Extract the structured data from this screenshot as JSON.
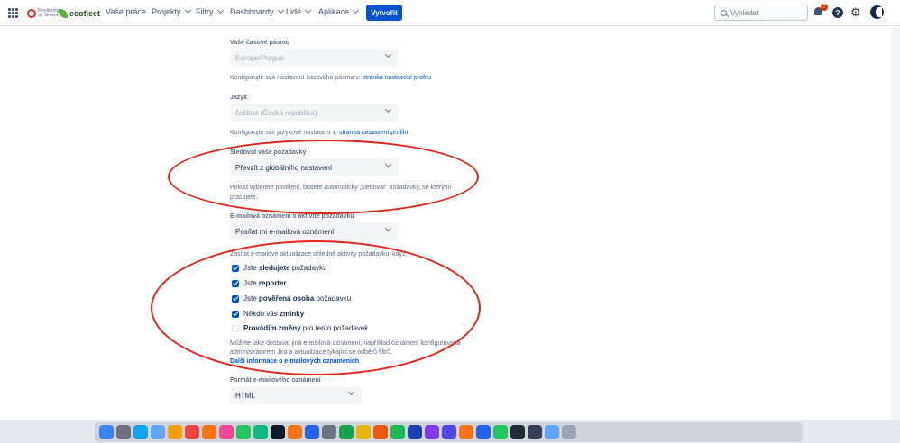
{
  "nav": {
    "logo1_text": "Monitoring as Service",
    "logo2_text": "ecofleet",
    "links": [
      "Vaše práce",
      "Projekty",
      "Filtry",
      "Dashboardy",
      "Lidé",
      "Aplikace"
    ],
    "create_label": "Vytvořit",
    "search_placeholder": "Vyhledat",
    "notification_count": "7",
    "help_glyph": "?"
  },
  "timezone": {
    "label": "Vaše časové pásmo",
    "value": "Europe/Prague",
    "hint_prefix": "Konfigurujte svá nastavení časového pásma v: ",
    "hint_link": "stránka nastavení profilu"
  },
  "language": {
    "label": "Jazyk",
    "value": "čeština (Česká republika)",
    "hint_prefix": "Konfigurujte své jazykové nastavení v: ",
    "hint_link": "stránka nastavení profilu"
  },
  "watch": {
    "label": "Sledovat vaše požadavky",
    "value": "Převzít z globálního nastavení",
    "hint_line1": "Pokud vyberete povolení, budete automaticky „sledovat\" požadavky, se kterými",
    "hint_line2": "pracujete."
  },
  "email_activity": {
    "label": "E-mailová oznámení o aktivitě požadavku",
    "value": "Posílat mi e-mailová oznámení"
  },
  "send_updates": {
    "label": "Zasílat e-mailové aktualizace ohledně aktivity požadavku, když:",
    "items": [
      {
        "pre": "Jste ",
        "bold": "sledujete",
        "post": " požadavku",
        "checked": true
      },
      {
        "pre": "Jste ",
        "bold": "reporter",
        "post": "",
        "checked": true
      },
      {
        "pre": "Jste ",
        "bold": "pověřená osoba",
        "post": " požadavku",
        "checked": true
      },
      {
        "pre": "Někdo vás ",
        "bold": "zmínky",
        "post": "",
        "checked": true
      },
      {
        "pre": "",
        "bold": "Provádím změny",
        "post": " pro tento požadavek",
        "checked": false
      }
    ],
    "hint_line1": "Můžete také dostávat jiná e-mailová oznámení, například oznámení konfigurovaná",
    "hint_line2": "administrátorem Jira a aktualizace týkající se odběrů filtrů.",
    "hint_link": "Další informace o e-mailových oznámeních"
  },
  "email_format": {
    "label": "Formát e-mailového oznámení",
    "value": "HTML"
  },
  "colors": {
    "primary": "#0052cc",
    "annotation": "#e0261c"
  },
  "dock_icons": [
    "finder-icon",
    "launchpad-icon",
    "safari-icon",
    "mail-icon",
    "notes-icon",
    "calendar-icon",
    "reminders-icon",
    "photos-icon",
    "messages-icon",
    "facetime-icon",
    "tv-icon",
    "books-icon",
    "appstore-icon",
    "preferences-icon",
    "maps-icon",
    "chrome-icon",
    "firefox-icon",
    "spotify-icon",
    "vpn-icon",
    "slack-icon",
    "teams-icon",
    "sublime-icon",
    "vscode-icon",
    "pycharm-icon",
    "terminal-icon",
    "activity-icon",
    "folder-icon",
    "trash-icon"
  ]
}
